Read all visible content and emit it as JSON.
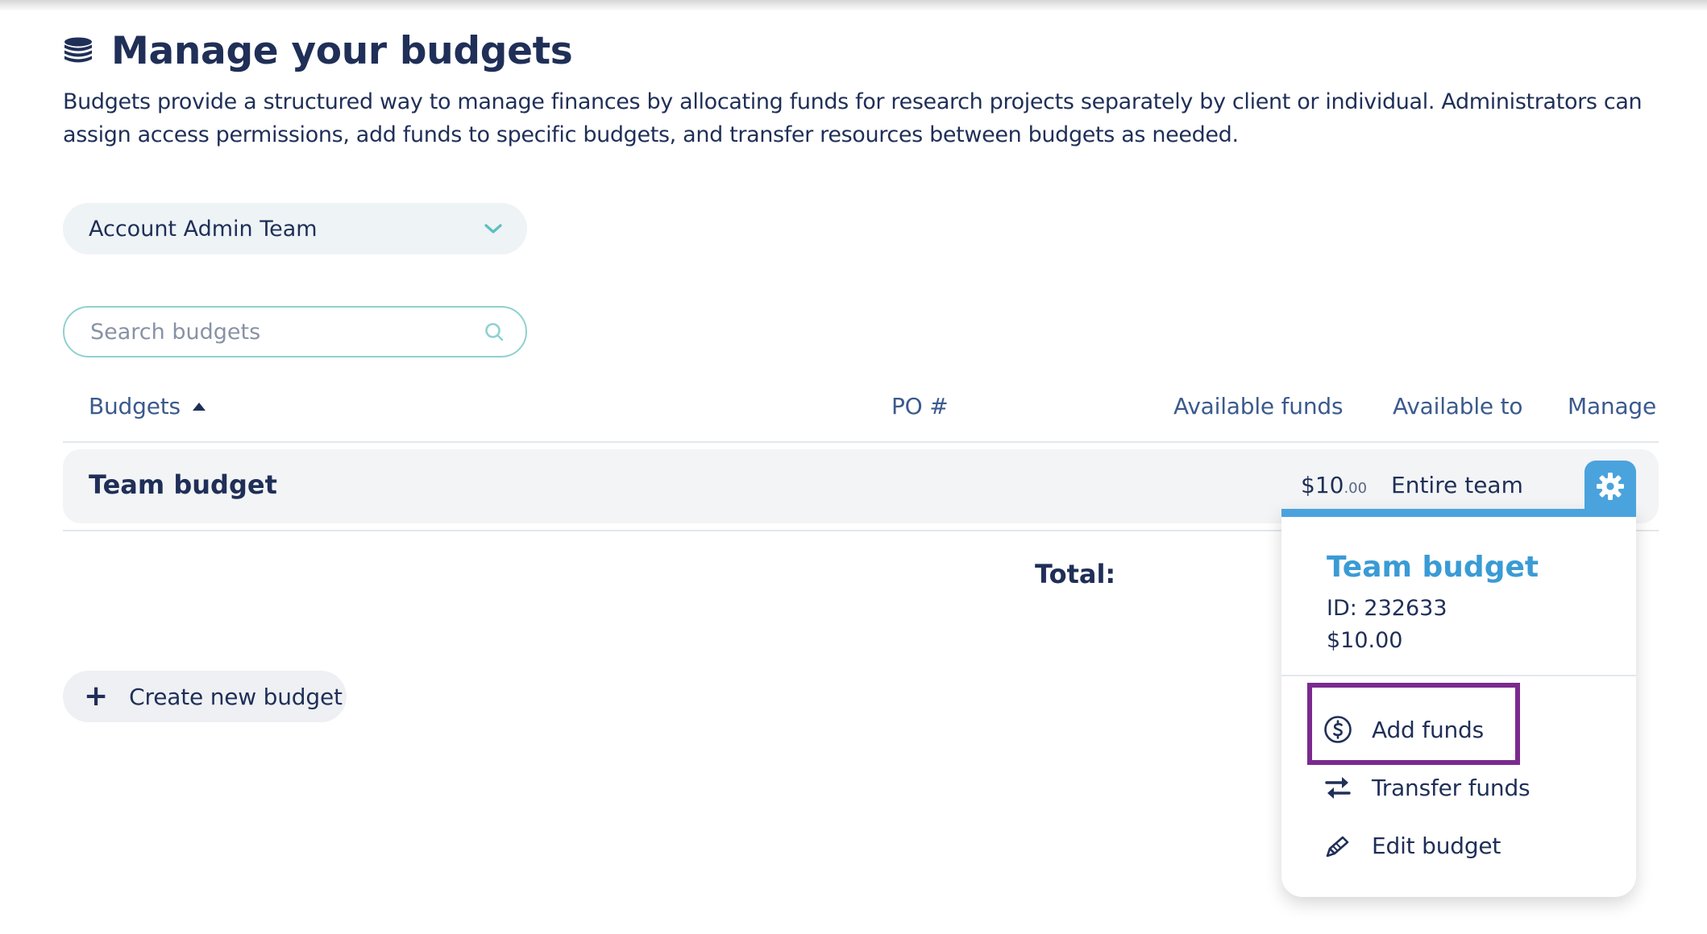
{
  "page": {
    "title": "Manage your budgets",
    "title_icon": "coins-stack-icon",
    "description": "Budgets provide a structured way to manage finances by allocating funds for research projects separately by client or individual. Administrators can assign access permissions, add funds to specific budgets, and transfer resources between budgets as needed."
  },
  "team_select": {
    "value": "Account Admin Team",
    "icon": "chevron-down-icon"
  },
  "search": {
    "placeholder": "Search budgets",
    "value": "",
    "icon": "search-icon"
  },
  "table": {
    "columns": {
      "budgets": "Budgets",
      "po": "PO #",
      "available_funds": "Available funds",
      "available_to": "Available to",
      "manage": "Manage"
    },
    "sort": {
      "column": "Budgets",
      "direction": "ascending"
    },
    "rows": [
      {
        "name": "Team budget",
        "po": "",
        "funds_dollars": "$10",
        "funds_cents": ".00",
        "available_to": "Entire team"
      }
    ],
    "total_label": "Total:",
    "total_value_partial": ")"
  },
  "create_button": {
    "icon": "plus-icon",
    "plus": "+",
    "label": "Create new budget"
  },
  "manage_popover": {
    "title": "Team budget",
    "id_line": "ID: 232633",
    "amount": "$10.00",
    "items": [
      {
        "label": "Add funds",
        "icon": "dollar-circle-icon"
      },
      {
        "label": "Transfer funds",
        "icon": "transfer-arrows-icon"
      },
      {
        "label": "Edit budget",
        "icon": "pencil-icon"
      }
    ]
  },
  "colors": {
    "navy": "#1f2f57",
    "accent_blue": "#4aa3dd",
    "teal": "#5dbfbd",
    "highlight_purple": "#7b2a8e",
    "row_bg": "#f3f4f6"
  }
}
